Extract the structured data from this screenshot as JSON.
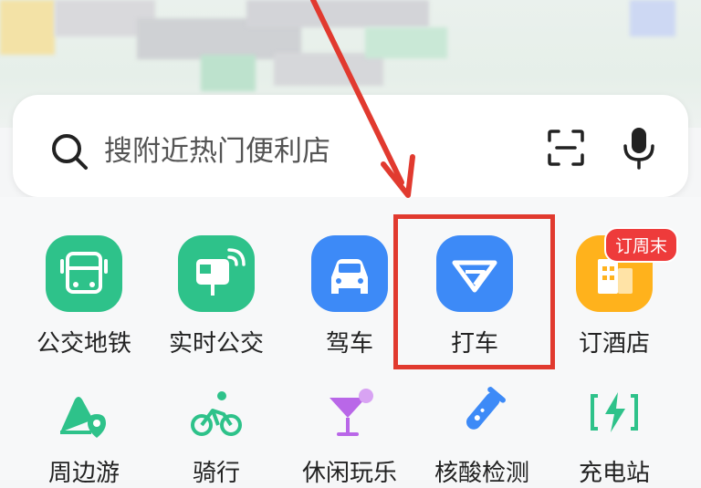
{
  "search": {
    "placeholder": "搜附近热门便利店"
  },
  "shortcuts_row1": [
    {
      "label": "公交地铁",
      "icon": "bus-icon",
      "color": "#2ec28a"
    },
    {
      "label": "实时公交",
      "icon": "bus-stop-icon",
      "color": "#2ec28a"
    },
    {
      "label": "驾车",
      "icon": "car-icon",
      "color": "#3d8af7"
    },
    {
      "label": "打车",
      "icon": "taxi-logo-icon",
      "color": "#3d8af7"
    },
    {
      "label": "订酒店",
      "icon": "hotel-icon",
      "color": "#ffb21c",
      "badge": "订周末"
    }
  ],
  "shortcuts_row2": [
    {
      "label": "周边游",
      "icon": "mountain-pin-icon"
    },
    {
      "label": "骑行",
      "icon": "bicycle-icon"
    },
    {
      "label": "休闲玩乐",
      "icon": "cocktail-icon"
    },
    {
      "label": "核酸检测",
      "icon": "test-tube-icon"
    },
    {
      "label": "充电站",
      "icon": "charging-icon"
    }
  ],
  "colors": {
    "annotation": "#e13a2f",
    "green": "#2ec28a",
    "blue": "#3d8af7",
    "orange": "#ffb21c"
  }
}
